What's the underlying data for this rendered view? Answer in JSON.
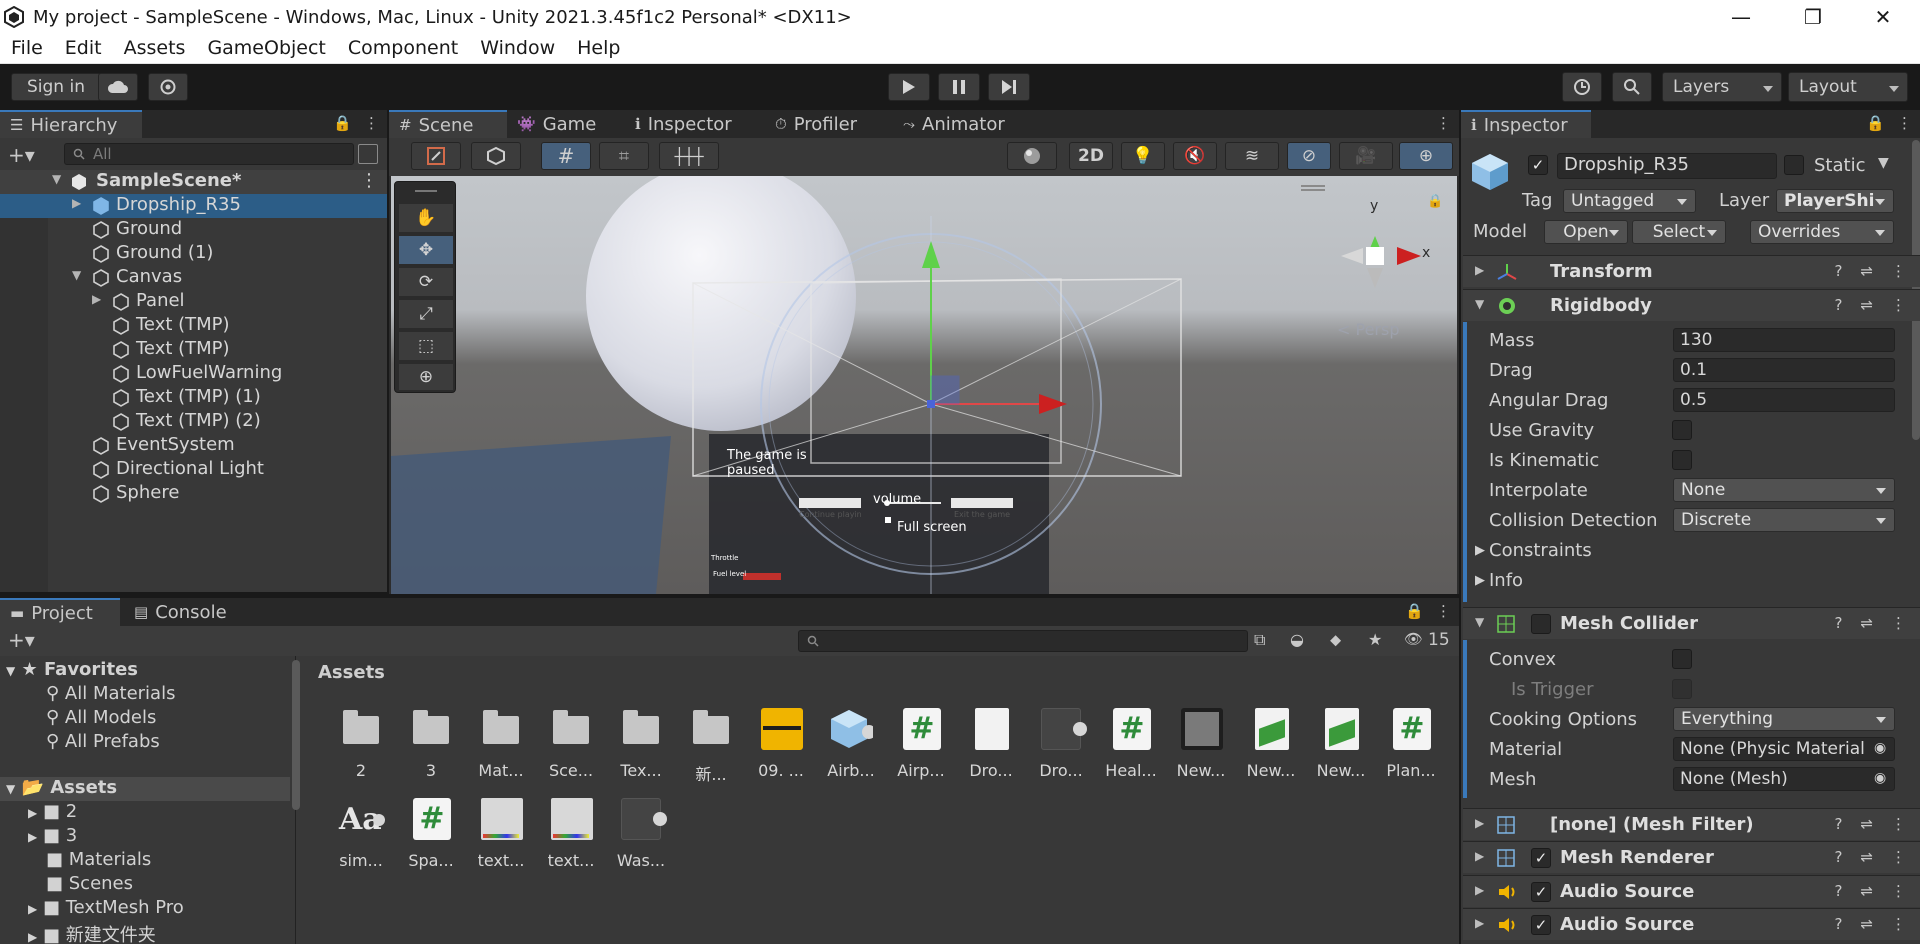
{
  "window": {
    "title": "My project - SampleScene - Windows, Mac, Linux - Unity 2021.3.45f1c2 Personal* <DX11>",
    "minimize": "—",
    "maximize": "❐",
    "close": "✕"
  },
  "menu": [
    "File",
    "Edit",
    "Assets",
    "GameObject",
    "Component",
    "Window",
    "Help"
  ],
  "toolbar": {
    "sign_in": "Sign in",
    "layers": "Layers",
    "layout": "Layout"
  },
  "hierarchy": {
    "tab": "Hierarchy",
    "search_placeholder": "All",
    "scene_name": "SampleScene*",
    "items": [
      {
        "label": "Dropship_R35",
        "prefab": true,
        "selected": true
      },
      {
        "label": "Ground"
      },
      {
        "label": "Ground (1)"
      },
      {
        "label": "Canvas"
      },
      {
        "label": "Panel"
      },
      {
        "label": "Text (TMP)"
      },
      {
        "label": "Text (TMP)"
      },
      {
        "label": "LowFuelWarning"
      },
      {
        "label": "Text (TMP) (1)"
      },
      {
        "label": "Text (TMP) (2)"
      },
      {
        "label": "EventSystem"
      },
      {
        "label": "Directional Light"
      },
      {
        "label": "Sphere"
      }
    ]
  },
  "center_tabs": [
    "Scene",
    "Game",
    "Inspector",
    "Profiler",
    "Animator"
  ],
  "scene": {
    "mode_2d": "2D",
    "persp_label": "< Persp",
    "gizmo_y": "y",
    "gizmo_x": "x",
    "ui_paused": "The game is paused",
    "ui_volume": "volume",
    "ui_fullscreen": "Full screen",
    "ui_continue": "Continue playing",
    "ui_exit": "Exit the game",
    "ui_throttle": "Throttle",
    "ui_fuel": "Fuel level"
  },
  "inspector": {
    "tab": "Inspector",
    "object_name": "Dropship_R35",
    "static_label": "Static",
    "tag_label": "Tag",
    "tag_value": "Untagged",
    "layer_label": "Layer",
    "layer_value": "PlayerShi",
    "model_label": "Model",
    "model_open": "Open",
    "model_select": "Select",
    "model_overrides": "Overrides",
    "components": {
      "transform": "Transform",
      "rigidbody": "Rigidbody",
      "mesh_collider": "Mesh Collider",
      "mesh_filter": "[none] (Mesh Filter)",
      "mesh_renderer": "Mesh Renderer",
      "audio_source_1": "Audio Source",
      "audio_source_2": "Audio Source"
    },
    "rigidbody": {
      "mass_label": "Mass",
      "mass": "130",
      "drag_label": "Drag",
      "drag": "0.1",
      "angular_drag_label": "Angular Drag",
      "angular_drag": "0.5",
      "use_gravity_label": "Use Gravity",
      "is_kinematic_label": "Is Kinematic",
      "interpolate_label": "Interpolate",
      "interpolate": "None",
      "collision_label": "Collision Detection",
      "collision": "Discrete",
      "constraints_label": "Constraints",
      "info_label": "Info"
    },
    "mesh_collider": {
      "convex_label": "Convex",
      "is_trigger_label": "Is Trigger",
      "cooking_label": "Cooking Options",
      "cooking": "Everything",
      "material_label": "Material",
      "material": "None (Physic Material",
      "mesh_label": "Mesh",
      "mesh": "None (Mesh)"
    }
  },
  "project": {
    "tab_project": "Project",
    "tab_console": "Console",
    "hidden_count": "15",
    "breadcrumb": "Assets",
    "favorites_label": "Favorites",
    "favorites": [
      "All Materials",
      "All Models",
      "All Prefabs"
    ],
    "assets_label": "Assets",
    "tree": [
      "2",
      "3",
      "Materials",
      "Scenes",
      "TextMesh Pro",
      "新建文件夹"
    ],
    "grid": [
      {
        "name": "2",
        "kind": "folder"
      },
      {
        "name": "3",
        "kind": "folder"
      },
      {
        "name": "Mat...",
        "kind": "folder"
      },
      {
        "name": "Sce...",
        "kind": "folder"
      },
      {
        "name": "Tex...",
        "kind": "folder"
      },
      {
        "name": "新...",
        "kind": "folder"
      },
      {
        "name": "09. ...",
        "kind": "audio"
      },
      {
        "name": "Airb...",
        "kind": "prefab"
      },
      {
        "name": "Airp...",
        "kind": "script"
      },
      {
        "name": "Dro...",
        "kind": "file"
      },
      {
        "name": "Dro...",
        "kind": "model"
      },
      {
        "name": "Heal...",
        "kind": "script"
      },
      {
        "name": "New...",
        "kind": "material"
      },
      {
        "name": "New...",
        "kind": "sprite"
      },
      {
        "name": "New...",
        "kind": "sprite"
      },
      {
        "name": "Plan...",
        "kind": "script"
      },
      {
        "name": "sim...",
        "kind": "font"
      },
      {
        "name": "Spa...",
        "kind": "script"
      },
      {
        "name": "text...",
        "kind": "texture"
      },
      {
        "name": "text...",
        "kind": "texture"
      },
      {
        "name": "Was...",
        "kind": "model"
      }
    ]
  }
}
